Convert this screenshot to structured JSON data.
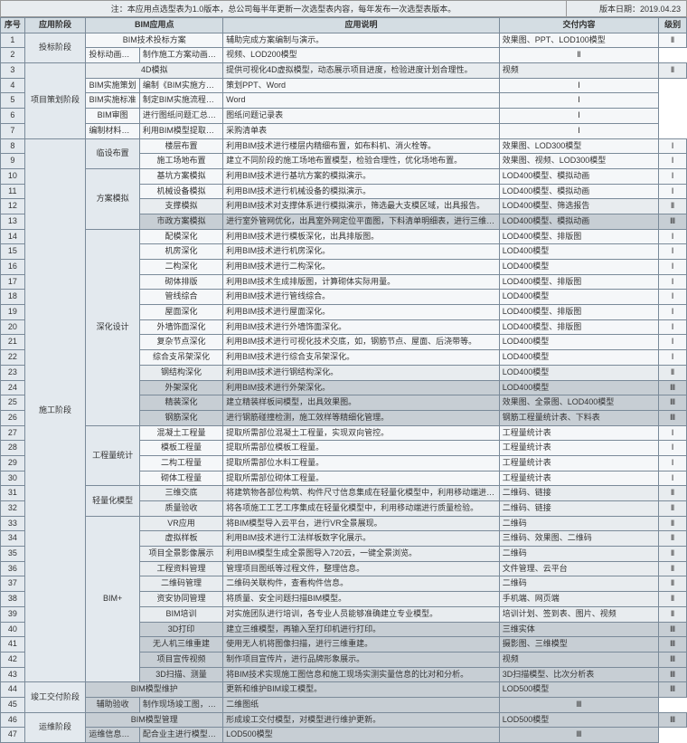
{
  "note_prefix": "注：本应用点选型表为1.0版本，总公司每半年更新一次选型表内容，每年发布一次选型表版本。",
  "version_date_label": "版本日期：2019.04.23",
  "headers": [
    "序号",
    "应用阶段",
    "BIM应用点",
    "应用说明",
    "交付内容",
    "级别"
  ],
  "rows": [
    {
      "seq": 1,
      "stage": "投标阶段",
      "stageRows": 2,
      "sub": "",
      "subRows": 0,
      "point": "BIM技术投标方案",
      "desc": "辅助完成方案编制与演示。",
      "deliver": "效果图、PPT、LOD100模型",
      "level": "Ⅱ"
    },
    {
      "seq": 2,
      "point": "投标动画演示",
      "desc": "制作施工方案动画，辅助投标方案演示。",
      "deliver": "视频、LOD200模型",
      "level": "Ⅱ"
    },
    {
      "seq": 3,
      "stage": "项目策划阶段",
      "stageRows": 5,
      "sub": "",
      "subRows": 0,
      "point": "4D模拟",
      "desc": "提供可视化4D虚拟模型，动态展示项目进度，检验进度计划合理性。",
      "deliver": "视频",
      "level": "Ⅱ",
      "cls": "lvl-2"
    },
    {
      "seq": 4,
      "point": "BIM实施策划",
      "desc": "编制《BIM实施方案》，有明确的组织机构与团队成员。",
      "deliver": "策划PPT、Word",
      "level": "Ⅰ"
    },
    {
      "seq": 5,
      "point": "BIM实施标准",
      "desc": "制定BIM实施流程与标准，统一标准和要求。",
      "deliver": "Word",
      "level": "Ⅰ"
    },
    {
      "seq": 6,
      "point": "BIM审图",
      "desc": "进行图纸问题汇总，记录成果。",
      "deliver": "图纸问题记录表",
      "level": "Ⅰ"
    },
    {
      "seq": 7,
      "point": "编制材料计划",
      "desc": "利用BIM模型提取材料用量，制定材料控制量与节点，编制材料采购计划。",
      "deliver": "采购清单表",
      "level": "Ⅰ"
    },
    {
      "seq": 8,
      "stage": "施工阶段",
      "stageRows": 36,
      "sub": "临设布置",
      "subRows": 2,
      "point": "楼层布置",
      "desc": "利用BIM技术进行楼层内精细布置，如布料机、消火栓等。",
      "deliver": "效果图、LOD300模型",
      "level": "Ⅰ"
    },
    {
      "seq": 9,
      "point": "施工场地布置",
      "desc": "建立不同阶段的施工场地布置模型，检验合理性，优化场地布置。",
      "deliver": "效果图、视频、LOD300模型",
      "level": "Ⅰ"
    },
    {
      "seq": 10,
      "sub": "方案模拟",
      "subRows": 4,
      "point": "基坑方案模拟",
      "desc": "利用BIM技术进行基坑方案的模拟演示。",
      "deliver": "LOD400模型、模拟动画",
      "level": "Ⅰ"
    },
    {
      "seq": 11,
      "point": "机械设备模拟",
      "desc": "利用BIM技术进行机械设备的模拟演示。",
      "deliver": "LOD400模型、模拟动画",
      "level": "Ⅰ"
    },
    {
      "seq": 12,
      "point": "支撑模拟",
      "desc": "利用BIM技术对支撑体系进行模拟演示，筛选最大支模区域，出具报告。",
      "deliver": "LOD400模型、筛选报告",
      "level": "Ⅱ",
      "cls": "lvl-2"
    },
    {
      "seq": 13,
      "point": "市政方案模拟",
      "desc": "进行室外管网优化，出具室外网定位平面图，下料清单明细表，进行三维可视化交底。",
      "deliver": "LOD400模型、模拟动画",
      "level": "Ⅲ",
      "cls": "lvl-3"
    },
    {
      "seq": 14,
      "sub": "深化设计",
      "subRows": 13,
      "point": "配模深化",
      "desc": "利用BIM技术进行模板深化，出具排版图。",
      "deliver": "LOD400模型、排版图",
      "level": "Ⅰ"
    },
    {
      "seq": 15,
      "point": "机房深化",
      "desc": "利用BIM技术进行机房深化。",
      "deliver": "LOD400模型",
      "level": "Ⅰ"
    },
    {
      "seq": 16,
      "point": "二构深化",
      "desc": "利用BIM技术进行二构深化。",
      "deliver": "LOD400模型",
      "level": "Ⅰ"
    },
    {
      "seq": 17,
      "point": "砌体排版",
      "desc": "利用BIM技术生成排版图，计算砌体实际用量。",
      "deliver": "LOD400模型、排版图",
      "level": "Ⅰ"
    },
    {
      "seq": 18,
      "point": "管线综合",
      "desc": "利用BIM技术进行管线综合。",
      "deliver": "LOD400模型",
      "level": "Ⅰ"
    },
    {
      "seq": 19,
      "point": "屋面深化",
      "desc": "利用BIM技术进行屋面深化。",
      "deliver": "LOD400模型、排版图",
      "level": "Ⅰ"
    },
    {
      "seq": 20,
      "point": "外墙饰面深化",
      "desc": "利用BIM技术进行外墙饰面深化。",
      "deliver": "LOD400模型、排版图",
      "level": "Ⅰ"
    },
    {
      "seq": 21,
      "point": "复杂节点深化",
      "desc": "利用BIM技术进行可视化技术交底，如，钢筋节点、屋面、后浇带等。",
      "deliver": "LOD400模型",
      "level": "Ⅰ"
    },
    {
      "seq": 22,
      "point": "综合支吊架深化",
      "desc": "利用BIM技术进行综合支吊架深化。",
      "deliver": "LOD400模型",
      "level": "Ⅰ"
    },
    {
      "seq": 23,
      "point": "钢结构深化",
      "desc": "利用BIM技术进行钢结构深化。",
      "deliver": "LOD400模型",
      "level": "Ⅱ",
      "cls": "lvl-2"
    },
    {
      "seq": 24,
      "point": "外架深化",
      "desc": "利用BIM技术进行外架深化。",
      "deliver": "LOD400模型",
      "level": "Ⅲ",
      "cls": "lvl-3"
    },
    {
      "seq": 25,
      "point": "精装深化",
      "desc": "建立精装样板间模型，出具效果图。",
      "deliver": "效果图、全景图、LOD400模型",
      "level": "Ⅲ",
      "cls": "lvl-3"
    },
    {
      "seq": 26,
      "point": "钢筋深化",
      "desc": "进行钢筋碰撞检测，施工效样等精细化管理。",
      "deliver": "钢筋工程量统计表、下料表",
      "level": "Ⅲ",
      "cls": "lvl-3"
    },
    {
      "seq": 27,
      "sub": "工程量统计",
      "subRows": 4,
      "point": "混凝土工程量",
      "desc": "提取所需部位混凝土工程量，实现双向管控。",
      "deliver": "工程量统计表",
      "level": "Ⅰ"
    },
    {
      "seq": 28,
      "point": "模板工程量",
      "desc": "提取所需部位模板工程量。",
      "deliver": "工程量统计表",
      "level": "Ⅰ"
    },
    {
      "seq": 29,
      "point": "二构工程量",
      "desc": "提取所需部位水料工程量。",
      "deliver": "工程量统计表",
      "level": "Ⅰ"
    },
    {
      "seq": 30,
      "point": "砌体工程量",
      "desc": "提取所需部位砌体工程量。",
      "deliver": "工程量统计表",
      "level": "Ⅰ"
    },
    {
      "seq": 31,
      "sub": "轻量化模型",
      "subRows": 2,
      "point": "三维交底",
      "desc": "将建筑物各部位构筑、构件尺寸信息集成在轻量化模型中，利用移动端进行技术交底、施工作业。",
      "deliver": "二维码、链接",
      "level": "Ⅱ",
      "cls": "lvl-2"
    },
    {
      "seq": 32,
      "point": "质量验收",
      "desc": "将各项施工工艺工序集成在轻量化模型中，利用移动端进行质量检验。",
      "deliver": "二维码、链接",
      "level": "Ⅱ",
      "cls": "lvl-2"
    },
    {
      "seq": 33,
      "sub": "BIM+",
      "subRows": 11,
      "point": "VR应用",
      "desc": "将BIM模型导入云平台，进行VR全景展现。",
      "deliver": "二维码",
      "level": "Ⅱ",
      "cls": "lvl-2"
    },
    {
      "seq": 34,
      "point": "虚拟样板",
      "desc": "利用BIM技术进行工法样板数字化展示。",
      "deliver": "三维码、效果图、二维码",
      "level": "Ⅱ",
      "cls": "lvl-2"
    },
    {
      "seq": 35,
      "point": "项目全景影像展示",
      "desc": "利用BIM模型生成全景图导入720云，一键全景浏览。",
      "deliver": "二维码",
      "level": "Ⅱ",
      "cls": "lvl-2"
    },
    {
      "seq": 36,
      "point": "工程资料管理",
      "desc": "管理项目图纸等过程文件，整理信息。",
      "deliver": "文件管理、云平台",
      "level": "Ⅱ",
      "cls": "lvl-2"
    },
    {
      "seq": 37,
      "point": "二维码管理",
      "desc": "二维码关联构件，查看构件信息。",
      "deliver": "二维码",
      "level": "Ⅱ",
      "cls": "lvl-2"
    },
    {
      "seq": 38,
      "point": "资安协同管理",
      "desc": "将质量、安全问题扫描BIM模型。",
      "deliver": "手机端、网页端",
      "level": "Ⅱ",
      "cls": "lvl-2"
    },
    {
      "seq": 39,
      "point": "BIM培训",
      "desc": "对实施团队进行培训，各专业人员能够准确建立专业模型。",
      "deliver": "培训计划、签到表、图片、视频",
      "level": "Ⅱ",
      "cls": "lvl-2"
    },
    {
      "seq": 40,
      "point": "3D打印",
      "desc": "建立三维模型，再输入至打印机进行打印。",
      "deliver": "三维实体",
      "level": "Ⅲ",
      "cls": "lvl-3"
    },
    {
      "seq": 41,
      "point": "无人机三维重建",
      "desc": "使用无人机将图像扫描，进行三维重建。",
      "deliver": "摄影图、三维模型",
      "level": "Ⅲ",
      "cls": "lvl-3"
    },
    {
      "seq": 42,
      "point": "项目宣传视频",
      "desc": "制作项目宣传片，进行品牌形象展示。",
      "deliver": "视频",
      "level": "Ⅲ",
      "cls": "lvl-3"
    },
    {
      "seq": 43,
      "point": "3D扫描、测量",
      "desc": "将BIM技术实现施工图信息和施工现场实测实量信息的比对和分析。",
      "deliver": "3D扫描模型、比次分析表",
      "level": "Ⅲ",
      "cls": "lvl-3"
    },
    {
      "seq": 44,
      "stage": "竣工交付阶段",
      "stageRows": 2,
      "sub": "",
      "subRows": 0,
      "point": "BIM模型维护",
      "desc": "更新和维护BIM竣工模型。",
      "deliver": "LOD500模型",
      "level": "Ⅲ",
      "cls": "lvl-3"
    },
    {
      "seq": 45,
      "point": "辅助验收",
      "desc": "制作现场竣工图，配合竣工验收。",
      "deliver": "二维图纸",
      "level": "Ⅲ",
      "cls": "lvl-3"
    },
    {
      "seq": 46,
      "stage": "运维阶段",
      "stageRows": 2,
      "sub": "",
      "subRows": 0,
      "point": "BIM模型管理",
      "desc": "形成竣工交付模型，对模型进行维护更新。",
      "deliver": "LOD500模型",
      "level": "Ⅲ",
      "cls": "lvl-3"
    },
    {
      "seq": 47,
      "point": "运维信息管理",
      "desc": "配合业主进行模型信息管理。",
      "deliver": "LOD500模型",
      "level": "Ⅲ",
      "cls": "lvl-3"
    }
  ]
}
